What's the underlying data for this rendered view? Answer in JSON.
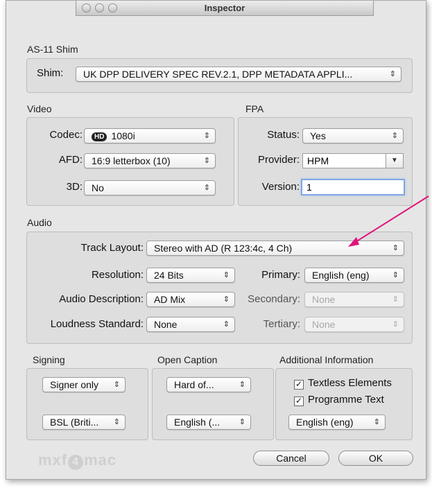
{
  "window": {
    "title": "Inspector"
  },
  "as11": {
    "section_label": "AS-11 Shim",
    "shim_label": "Shim:",
    "shim_value": "UK DPP DELIVERY SPEC REV.2.1, DPP METADATA APPLI..."
  },
  "video": {
    "section_label": "Video",
    "codec_label": "Codec:",
    "codec_badge": "HD",
    "codec_value": "1080i",
    "afd_label": "AFD:",
    "afd_value": "16:9 letterbox (10)",
    "threed_label": "3D:",
    "threed_value": "No"
  },
  "fpa": {
    "section_label": "FPA",
    "status_label": "Status:",
    "status_value": "Yes",
    "provider_label": "Provider:",
    "provider_value": "HPM",
    "version_label": "Version:",
    "version_value": "1"
  },
  "audio": {
    "section_label": "Audio",
    "track_layout_label": "Track Layout:",
    "track_layout_value": "Stereo with AD (R 123:4c, 4 Ch)",
    "resolution_label": "Resolution:",
    "resolution_value": "24 Bits",
    "primary_label": "Primary:",
    "primary_value": "English (eng)",
    "audio_desc_label": "Audio Description:",
    "audio_desc_value": "AD Mix",
    "secondary_label": "Secondary:",
    "secondary_value": "None",
    "loudness_label": "Loudness Standard:",
    "loudness_value": "None",
    "tertiary_label": "Tertiary:",
    "tertiary_value": "None"
  },
  "signing": {
    "section_label": "Signing",
    "signer_value": "Signer only",
    "language_value": "BSL (Briti..."
  },
  "open_caption": {
    "section_label": "Open Caption",
    "type_value": "Hard of...",
    "language_value": "English (..."
  },
  "additional": {
    "section_label": "Additional Information",
    "textless_label": "Textless Elements",
    "programme_text_label": "Programme Text",
    "language_value": "English (eng)"
  },
  "footer": {
    "logo_prefix": "mxf",
    "logo_digit": "4",
    "logo_suffix": "mac",
    "cancel_label": "Cancel",
    "ok_label": "OK"
  },
  "colors": {
    "annotation_arrow": "#e0147c",
    "focus_ring": "#7fa8e0"
  },
  "icons": {
    "check": "✓",
    "popup_arrows": "⇕"
  }
}
